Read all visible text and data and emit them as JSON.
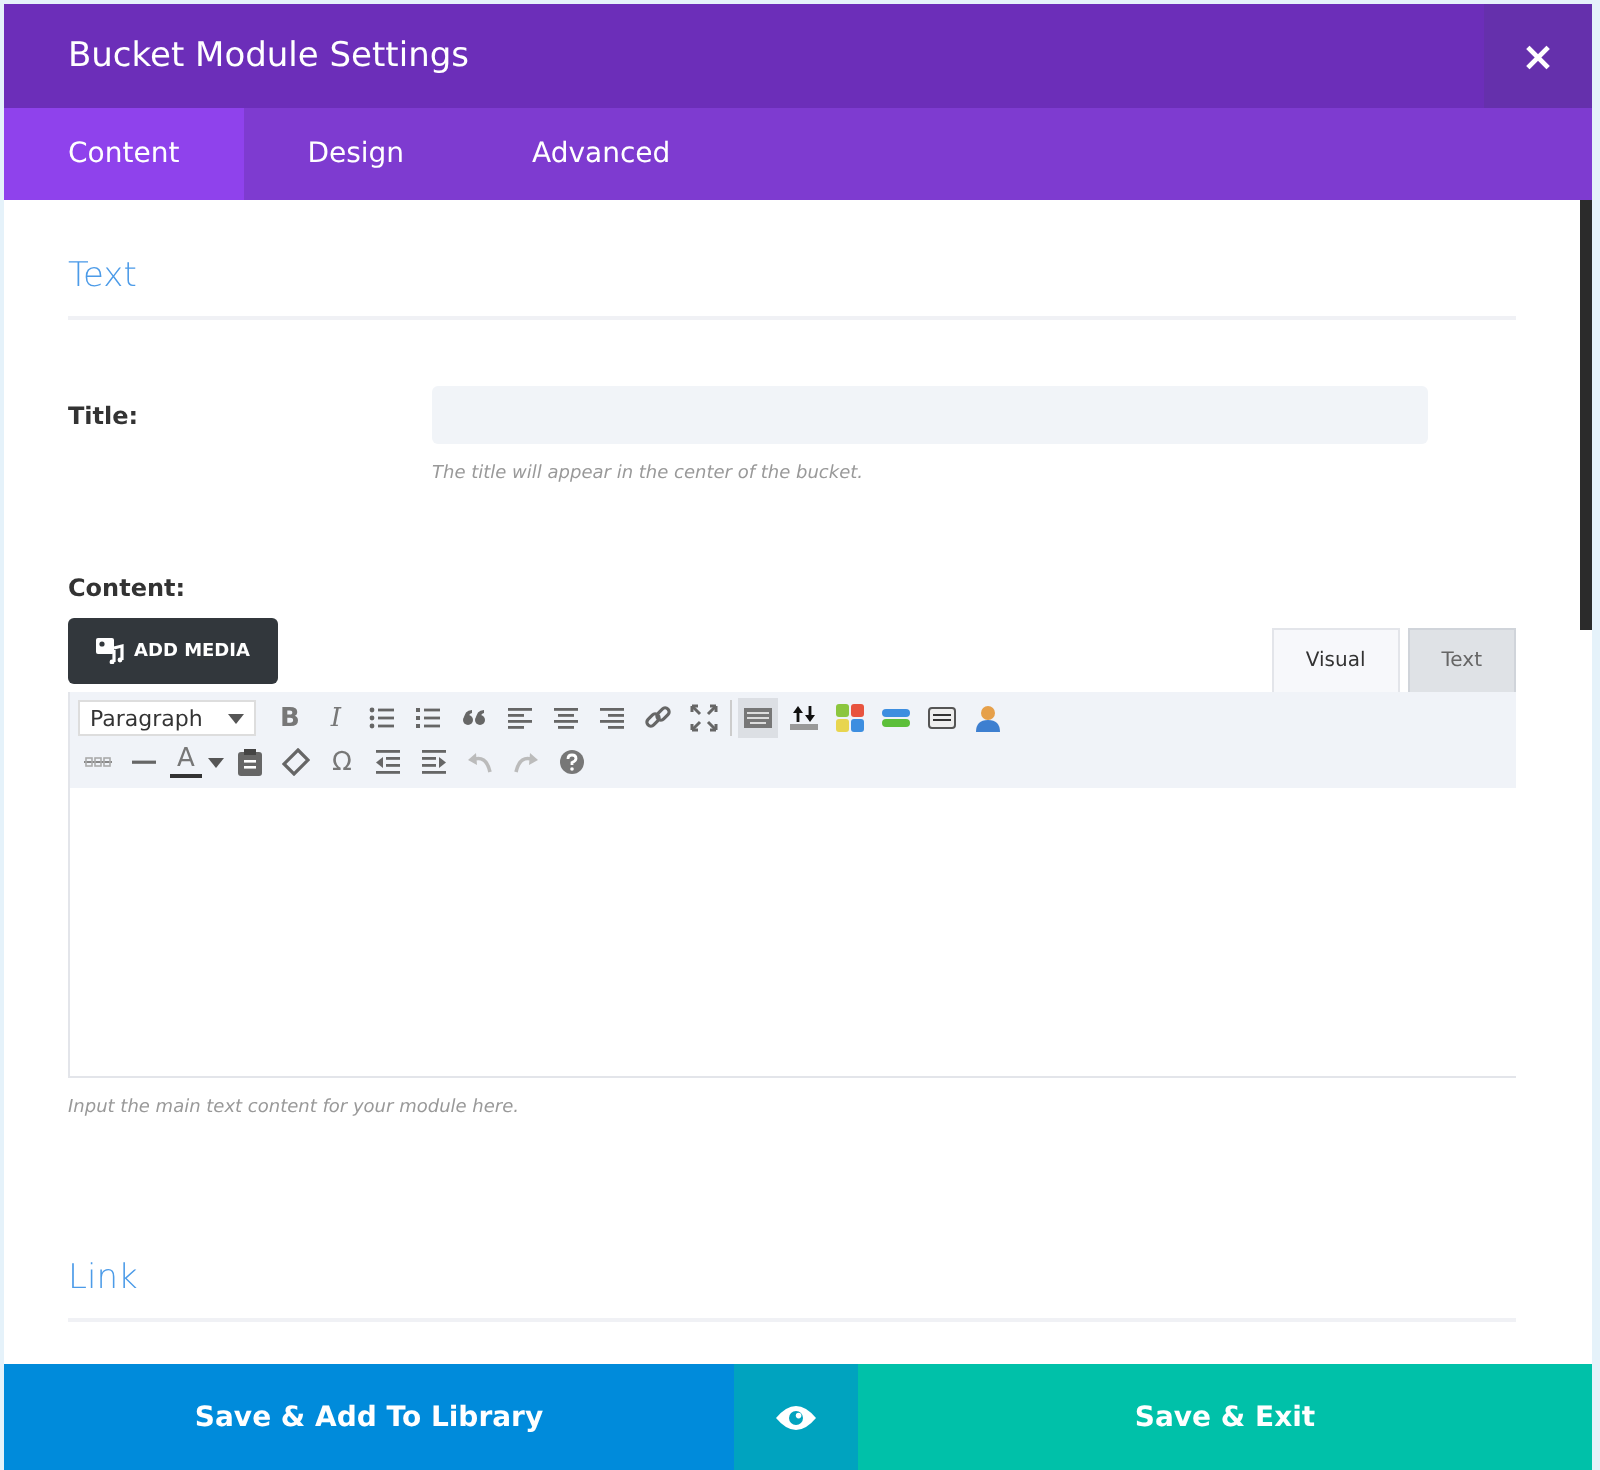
{
  "window": {
    "title": "Bucket Module Settings",
    "close": "×"
  },
  "tabs": [
    {
      "label": "Content",
      "selected": true
    },
    {
      "label": "Design",
      "selected": false
    },
    {
      "label": "Advanced",
      "selected": false
    }
  ],
  "sections": [
    {
      "heading": "Text"
    }
  ],
  "title_field": {
    "label": "Title:",
    "hint": "The title will appear in the center of the bucket."
  },
  "content_field": {
    "label": "Content:",
    "add_media": "ADD MEDIA",
    "editor_tabs": [
      {
        "label": "Visual",
        "selected": true
      },
      {
        "label": "Text",
        "selected": false
      }
    ],
    "format_select": "Paragraph",
    "toolbar_rows": [
      [
        {
          "kind": "glyph",
          "label": "B",
          "active": false
        },
        {
          "kind": "glyph",
          "label": "I",
          "active": false
        },
        {
          "kind": "icon",
          "active": false
        },
        {
          "kind": "icon",
          "active": false
        },
        {
          "kind": "icon",
          "active": false
        },
        {
          "kind": "icon",
          "active": false
        },
        {
          "kind": "icon",
          "active": false
        },
        {
          "kind": "icon",
          "active": false
        },
        {
          "kind": "icon",
          "active": false
        },
        {
          "kind": "icon",
          "active": false
        },
        {
          "kind": "icon",
          "active": true
        },
        {
          "kind": "icon",
          "active": false
        },
        {
          "kind": "icon",
          "active": false
        },
        {
          "kind": "icon",
          "active": false
        },
        {
          "kind": "icon",
          "active": false
        },
        {
          "kind": "icon",
          "active": false
        }
      ],
      [
        {
          "kind": "icon",
          "active": false
        },
        {
          "kind": "icon",
          "active": false
        },
        {
          "kind": "glyph",
          "label": "A",
          "active": false
        },
        {
          "kind": "icon",
          "active": false
        },
        {
          "kind": "icon",
          "active": false
        },
        {
          "kind": "glyph",
          "label": "Ω",
          "active": false
        },
        {
          "kind": "icon",
          "active": false
        },
        {
          "kind": "icon",
          "active": false
        },
        {
          "kind": "icon",
          "active": false
        },
        {
          "kind": "icon",
          "active": false
        },
        {
          "kind": "icon",
          "active": false
        }
      ]
    ],
    "hint": "Input the main text content for your module here."
  },
  "link_section": {
    "heading": "Link"
  },
  "footer": {
    "library_button": "Save & Add To Library",
    "exit_button": "Save & Exit"
  }
}
